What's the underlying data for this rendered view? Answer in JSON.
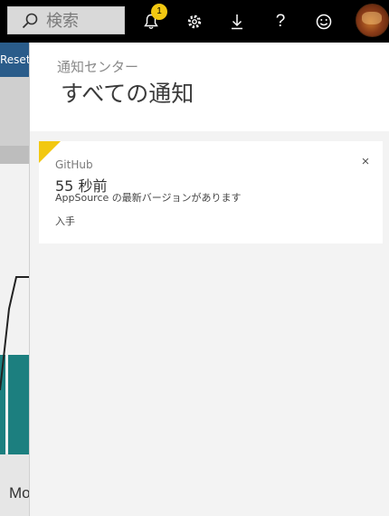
{
  "topbar": {
    "search_placeholder": "検索",
    "notification_count": "1",
    "icons": [
      "bell-icon",
      "gear-icon",
      "download-icon",
      "help-icon",
      "smiley-icon",
      "avatar"
    ],
    "help_glyph": "?"
  },
  "background_page": {
    "toolbar_fragment": "Reset",
    "label_fragment": "Mo"
  },
  "notification_center": {
    "subtitle": "通知センター",
    "title": "すべての通知",
    "notifications": [
      {
        "source": "GitHub",
        "time": "55 秒前",
        "message": "AppSource の最新バージョンがあります",
        "action_label": "入手",
        "close_glyph": "×",
        "accent_color": "#f2c811"
      }
    ]
  },
  "colors": {
    "topbar": "#000000",
    "badge": "#f2c811",
    "pane_bg": "#f3f3f3",
    "card_bg": "#ffffff"
  }
}
